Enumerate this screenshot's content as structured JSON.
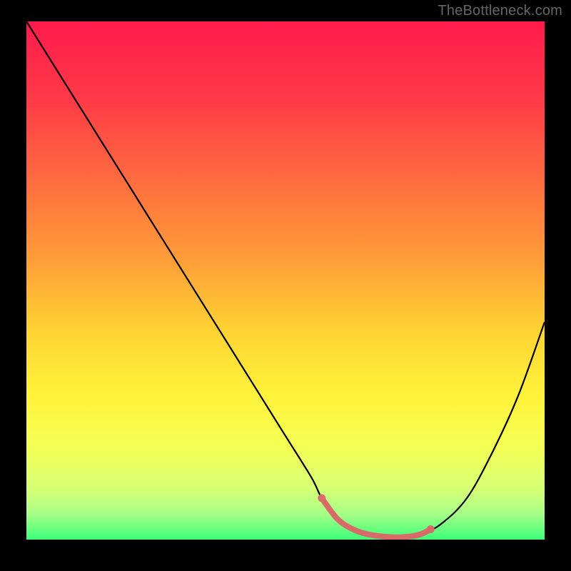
{
  "watermark": "TheBottleneck.com",
  "chart_data": {
    "type": "line",
    "title": "",
    "xlabel": "",
    "ylabel": "",
    "xlim": [
      0,
      100
    ],
    "ylim": [
      0,
      100
    ],
    "grid": false,
    "series": [
      {
        "name": "curve",
        "x": [
          0,
          5,
          10,
          15,
          20,
          25,
          30,
          35,
          40,
          45,
          50,
          55,
          57,
          60,
          63,
          66,
          70,
          73,
          76,
          80,
          85,
          90,
          95,
          100
        ],
        "y": [
          100,
          92,
          84,
          76,
          68,
          60,
          52,
          44,
          36,
          28,
          20,
          12,
          8,
          4,
          2,
          1,
          0.5,
          0.5,
          1,
          3,
          8,
          17,
          28,
          42
        ],
        "color": "#000000"
      },
      {
        "name": "highlight",
        "x": [
          57,
          60,
          63,
          66,
          70,
          73,
          76,
          78
        ],
        "y": [
          8,
          4,
          2,
          1,
          0.5,
          0.5,
          1,
          2
        ],
        "color": "#d96a6a"
      }
    ],
    "gradient_stops": [
      {
        "offset": 0.0,
        "color": "#ff1a4d"
      },
      {
        "offset": 0.15,
        "color": "#ff3a47"
      },
      {
        "offset": 0.3,
        "color": "#ff6a3f"
      },
      {
        "offset": 0.45,
        "color": "#ff9a38"
      },
      {
        "offset": 0.6,
        "color": "#ffd433"
      },
      {
        "offset": 0.72,
        "color": "#fff23a"
      },
      {
        "offset": 0.82,
        "color": "#f4ff55"
      },
      {
        "offset": 0.9,
        "color": "#d8ff74"
      },
      {
        "offset": 0.95,
        "color": "#a8ff88"
      },
      {
        "offset": 1.0,
        "color": "#3dff7a"
      }
    ],
    "highlight_endpoints": [
      {
        "x": 57,
        "y": 8
      },
      {
        "x": 78,
        "y": 2
      }
    ]
  }
}
